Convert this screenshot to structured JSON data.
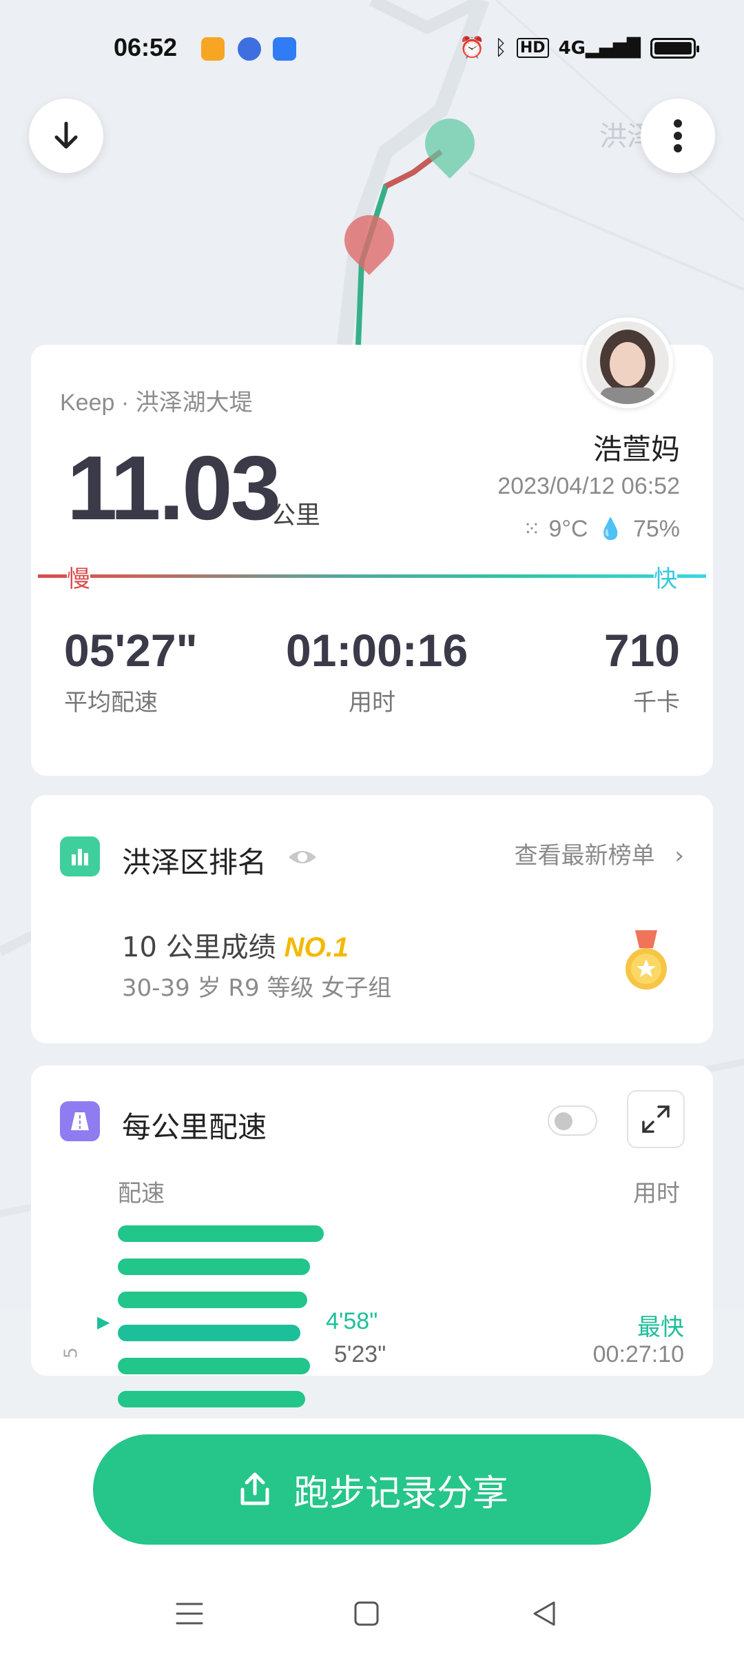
{
  "status_bar": {
    "time": "06:52",
    "app_icons": [
      "keep-app-icon",
      "baidu-app-icon",
      "cloud-app-icon"
    ],
    "system_icons": [
      "alarm-icon",
      "bluetooth-icon",
      "hd-icon",
      "4g-signal-icon",
      "battery-icon"
    ]
  },
  "map": {
    "place_label": "洪泽"
  },
  "summary": {
    "source": "Keep · 洪泽湖大堤",
    "distance": "11.03",
    "distance_unit": "公里",
    "username": "浩萱妈",
    "datetime": "2023/04/12 06:52",
    "temperature": "9°C",
    "humidity": "75%",
    "slow_label": "慢",
    "fast_label": "快",
    "metrics": [
      {
        "value": "05'27\"",
        "label": "平均配速"
      },
      {
        "value": "01:00:16",
        "label": "用时"
      },
      {
        "value": "710",
        "label": "千卡"
      }
    ]
  },
  "ranking": {
    "title": "洪泽区排名",
    "link": "查看最新榜单",
    "record": "10 公里成绩",
    "rank": "NO.1",
    "group": "30-39 岁 R9 等级 女子组"
  },
  "splits": {
    "title": "每公里配速",
    "pace_header": "配速",
    "time_header": "用时",
    "fastest_label": "最快",
    "fastest_pace": "4'58\"",
    "km5_pace": "5'23\"",
    "km5_time": "00:27:10",
    "km5_index": "5",
    "bars": [
      0.88,
      0.82,
      0.81,
      0.78,
      0.82,
      0.8
    ]
  },
  "share": {
    "label": "跑步记录分享"
  },
  "colors": {
    "accent": "#26c58a",
    "slow": "#d94c4c",
    "fast": "#36c8df",
    "gold": "#f5b800"
  }
}
